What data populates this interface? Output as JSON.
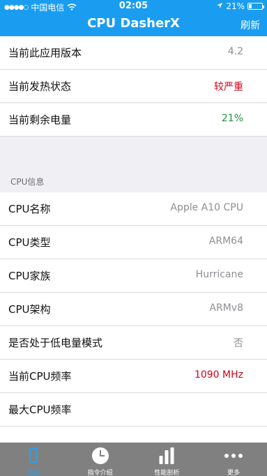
{
  "status_bar": {
    "carrier": "中国电信",
    "time": "02:05",
    "battery": "21%",
    "battery_level": 0.21
  },
  "nav": {
    "title": "CPU DasherX",
    "refresh_label": "刷新"
  },
  "rows_top": [
    {
      "label": "当前此应用版本",
      "value": "4.2",
      "tone": "gray"
    },
    {
      "label": "当前发热状态",
      "value": "较严重",
      "tone": "red"
    },
    {
      "label": "当前剩余电量",
      "value": "21%",
      "tone": "green"
    }
  ],
  "section_cpu": {
    "header": "CPU信息",
    "rows": [
      {
        "label": "CPU名称",
        "value": "Apple A10 CPU",
        "tone": "gray"
      },
      {
        "label": "CPU类型",
        "value": "ARM64",
        "tone": "gray"
      },
      {
        "label": "CPU家族",
        "value": "Hurricane",
        "tone": "gray"
      },
      {
        "label": "CPU架构",
        "value": "ARMv8",
        "tone": "gray"
      },
      {
        "label": "是否处于低电量模式",
        "value": "否",
        "tone": "gray"
      },
      {
        "label": "当前CPU频率",
        "value": "1090 MHz",
        "tone": "red"
      },
      {
        "label": "最大CPU频率",
        "value": "",
        "tone": "gray"
      }
    ]
  },
  "tabs": [
    {
      "label": "我的",
      "icon": "phone-icon",
      "active": true
    },
    {
      "label": "指令介绍",
      "icon": "clock-icon",
      "active": false
    },
    {
      "label": "性能剖析",
      "icon": "bars-icon",
      "active": false
    },
    {
      "label": "更多",
      "icon": "more-dots-icon",
      "active": false
    }
  ],
  "colors": {
    "accent": "#1a9df0",
    "red": "#d0021b",
    "green": "#1f8f3a",
    "tabbar": "#808080"
  }
}
